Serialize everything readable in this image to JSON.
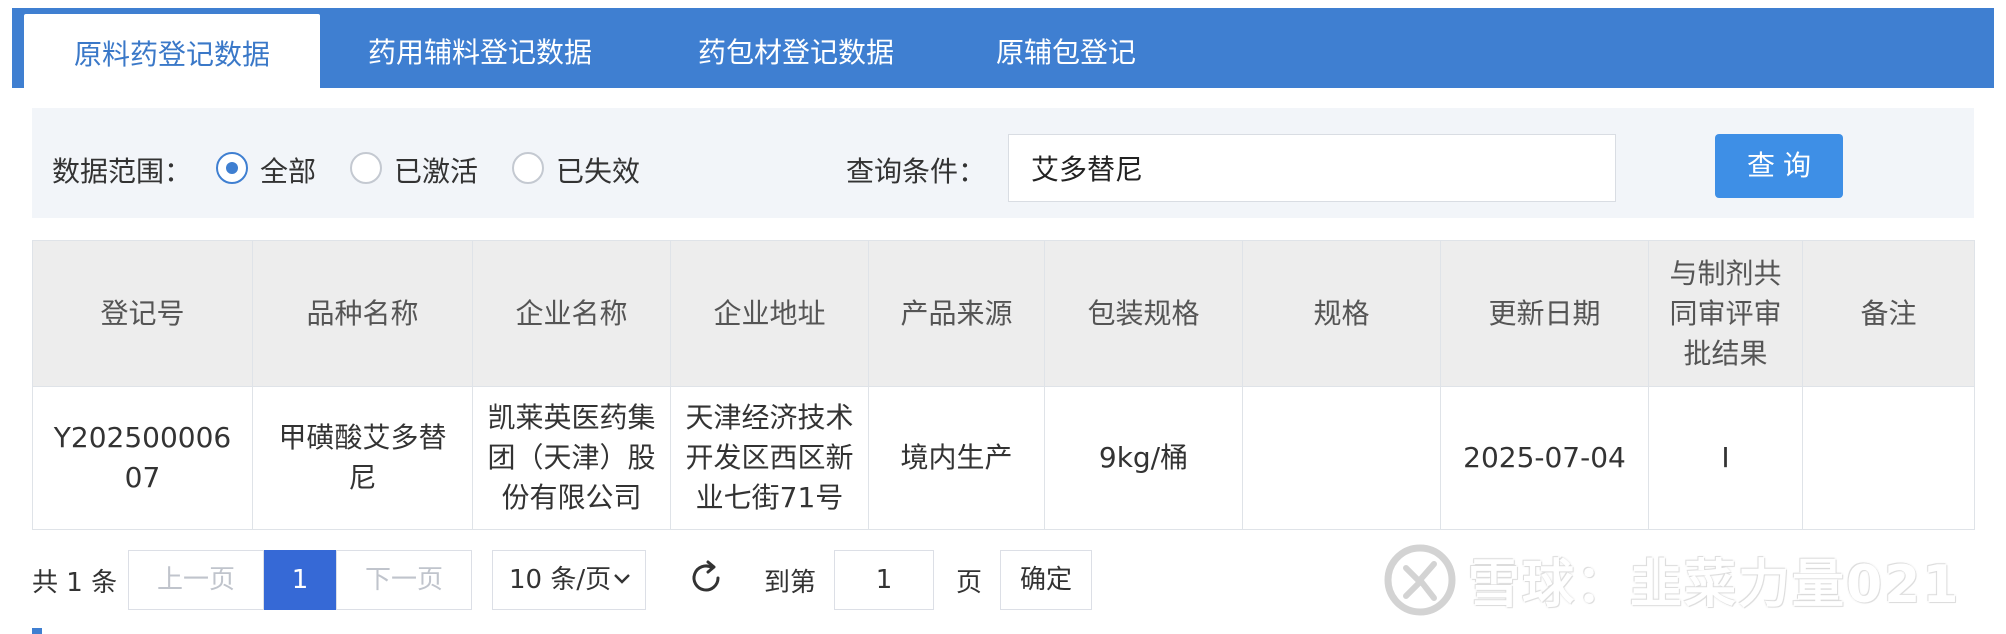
{
  "tabs": [
    {
      "label": "原料药登记数据",
      "active": true
    },
    {
      "label": "药用辅料登记数据",
      "active": false
    },
    {
      "label": "药包材登记数据",
      "active": false
    },
    {
      "label": "原辅包登记",
      "active": false
    }
  ],
  "filter": {
    "scope_label": "数据范围：",
    "options": [
      {
        "label": "全部",
        "checked": true
      },
      {
        "label": "已激活",
        "checked": false
      },
      {
        "label": "已失效",
        "checked": false
      }
    ],
    "query_label": "查询条件：",
    "query_value": "艾多替尼",
    "query_button": "查询"
  },
  "table": {
    "columns": [
      "登记号",
      "品种名称",
      "企业名称",
      "企业地址",
      "产品来源",
      "包装规格",
      "规格",
      "更新日期",
      "与制剂共同审评审批结果",
      "备注"
    ],
    "rows": [
      [
        "Y20250000607",
        "甲磺酸艾多替尼",
        "凯莱英医药集团（天津）股份有限公司",
        "天津经济技术开发区西区新业七街71号",
        "境内生产",
        "9kg/桶",
        "",
        "2025-07-04",
        "I",
        ""
      ]
    ]
  },
  "pagination": {
    "total_prefix": "共",
    "total_count": "1",
    "total_suffix": "条",
    "prev": "上一页",
    "current": "1",
    "next": "下一页",
    "page_size": "10 条/页",
    "goto_label": "到第",
    "goto_value": "1",
    "page_unit": "页",
    "confirm": "确定"
  },
  "watermark": {
    "text": "雪球：韭菜力量021"
  },
  "colors": {
    "primary": "#3f7fd1",
    "button": "#3e8fe6",
    "current_page": "#3669d6"
  }
}
